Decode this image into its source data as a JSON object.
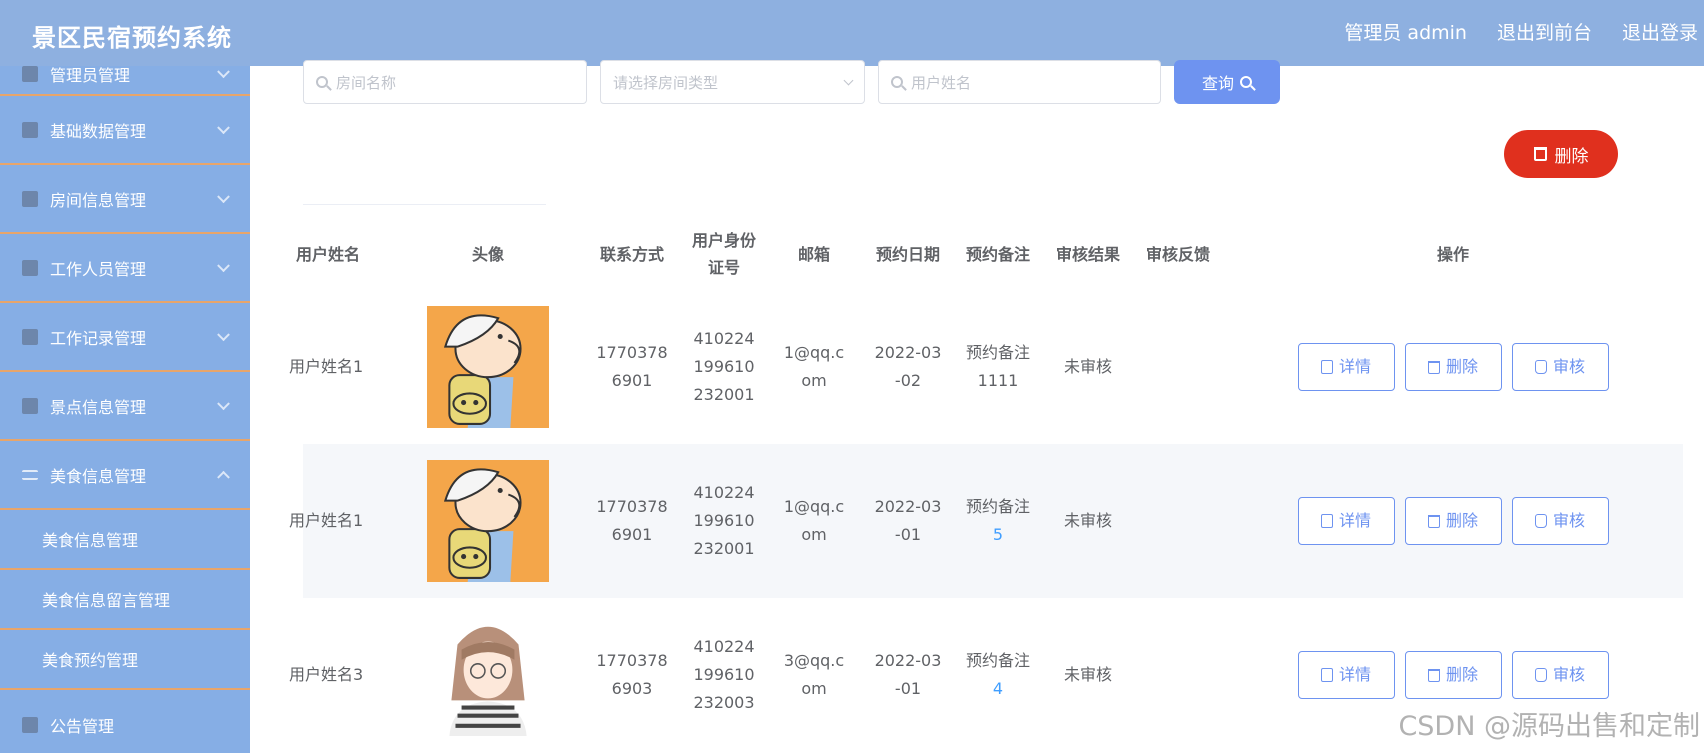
{
  "app": {
    "title": "景区民宿预约系统"
  },
  "header": {
    "user_label": "管理员 admin",
    "to_front": "退出到前台",
    "logout": "退出登录"
  },
  "sidebar": {
    "items": [
      {
        "label": "管理员管理"
      },
      {
        "label": "基础数据管理"
      },
      {
        "label": "房间信息管理"
      },
      {
        "label": "工作人员管理"
      },
      {
        "label": "工作记录管理"
      },
      {
        "label": "景点信息管理"
      },
      {
        "label": "美食信息管理"
      }
    ],
    "sub_items": [
      {
        "label": "美食信息管理"
      },
      {
        "label": "美食信息留言管理"
      },
      {
        "label": "美食预约管理"
      }
    ],
    "bottom_item": {
      "label": "公告管理"
    }
  },
  "search": {
    "room_name_placeholder": "房间名称",
    "room_type_placeholder": "请选择房间类型",
    "user_name_placeholder": "用户姓名",
    "query_label": "查询"
  },
  "actions": {
    "bulk_delete_label": "删除"
  },
  "table": {
    "headers": [
      "用户姓名",
      "头像",
      "联系方式",
      "用户身份证号",
      "邮箱",
      "预约日期",
      "预约备注",
      "审核结果",
      "审核反馈",
      "操作"
    ],
    "rows": [
      {
        "name": "用户姓名1",
        "avatar": "cartoon-boy",
        "phone": "17703786901",
        "id_card": "410224199610232001",
        "email": "1@qq.com",
        "date": "2022-03-02",
        "note_prefix": "预约备注",
        "note_num": "1111",
        "status": "未审核",
        "feedback": ""
      },
      {
        "name": "用户姓名1",
        "avatar": "cartoon-boy",
        "phone": "17703786901",
        "id_card": "410224199610232001",
        "email": "1@qq.com",
        "date": "2022-03-01",
        "note_prefix": "预约备注",
        "note_num": "5",
        "status": "未审核",
        "feedback": ""
      },
      {
        "name": "用户姓名3",
        "avatar": "cartoon-girl",
        "phone": "17703786903",
        "id_card": "410224199610232003",
        "email": "3@qq.com",
        "date": "2022-03-01",
        "note_prefix": "预约备注",
        "note_num": "4",
        "status": "未审核",
        "feedback": ""
      }
    ],
    "row_buttons": {
      "detail": "详情",
      "delete": "删除",
      "review": "审核"
    }
  },
  "watermark": "CSDN @源码出售和定制",
  "colors": {
    "topbar": "#8eb0e0",
    "sidebar": "#86aee5",
    "menu_divider": "#e7a56b",
    "primary": "#6e93f0",
    "danger": "#e0301e"
  }
}
